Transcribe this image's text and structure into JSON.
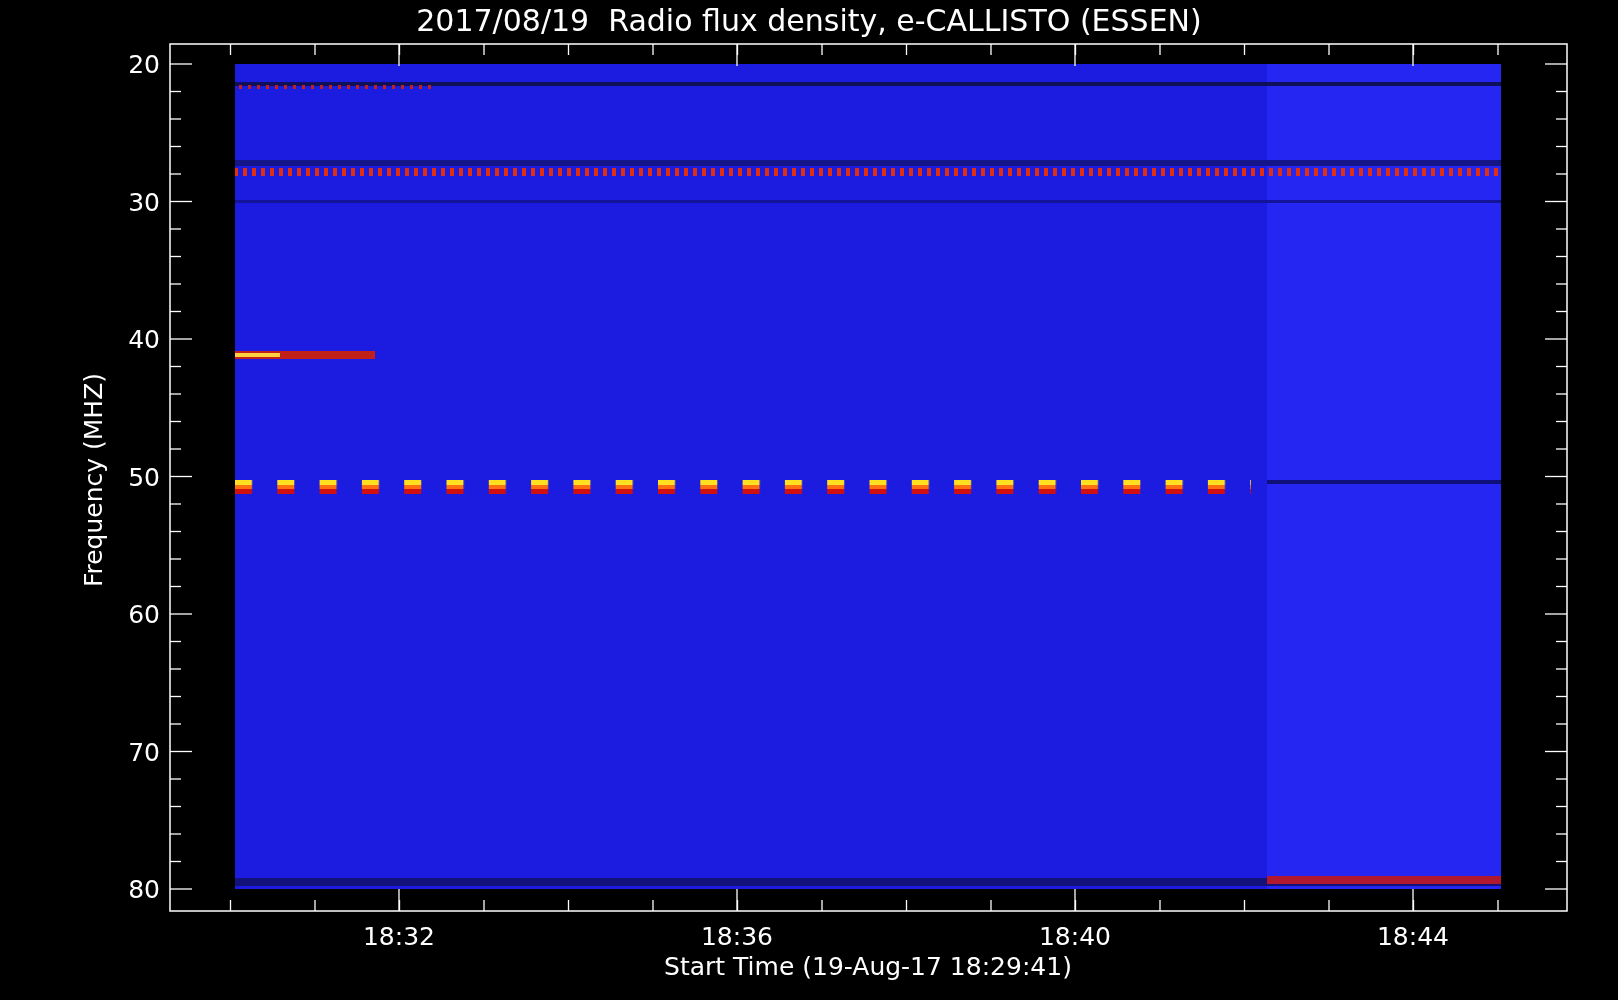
{
  "title": "2017/08/19  Radio flux density, e-CALLISTO (ESSEN)",
  "ylabel": "Frequency (MHZ)",
  "xlabel": "Start Time (19-Aug-17 18:29:41)",
  "yticks": [
    "20",
    "30",
    "40",
    "50",
    "60",
    "70",
    "80"
  ],
  "xticks": [
    "18:32",
    "18:36",
    "18:40",
    "18:44"
  ]
}
